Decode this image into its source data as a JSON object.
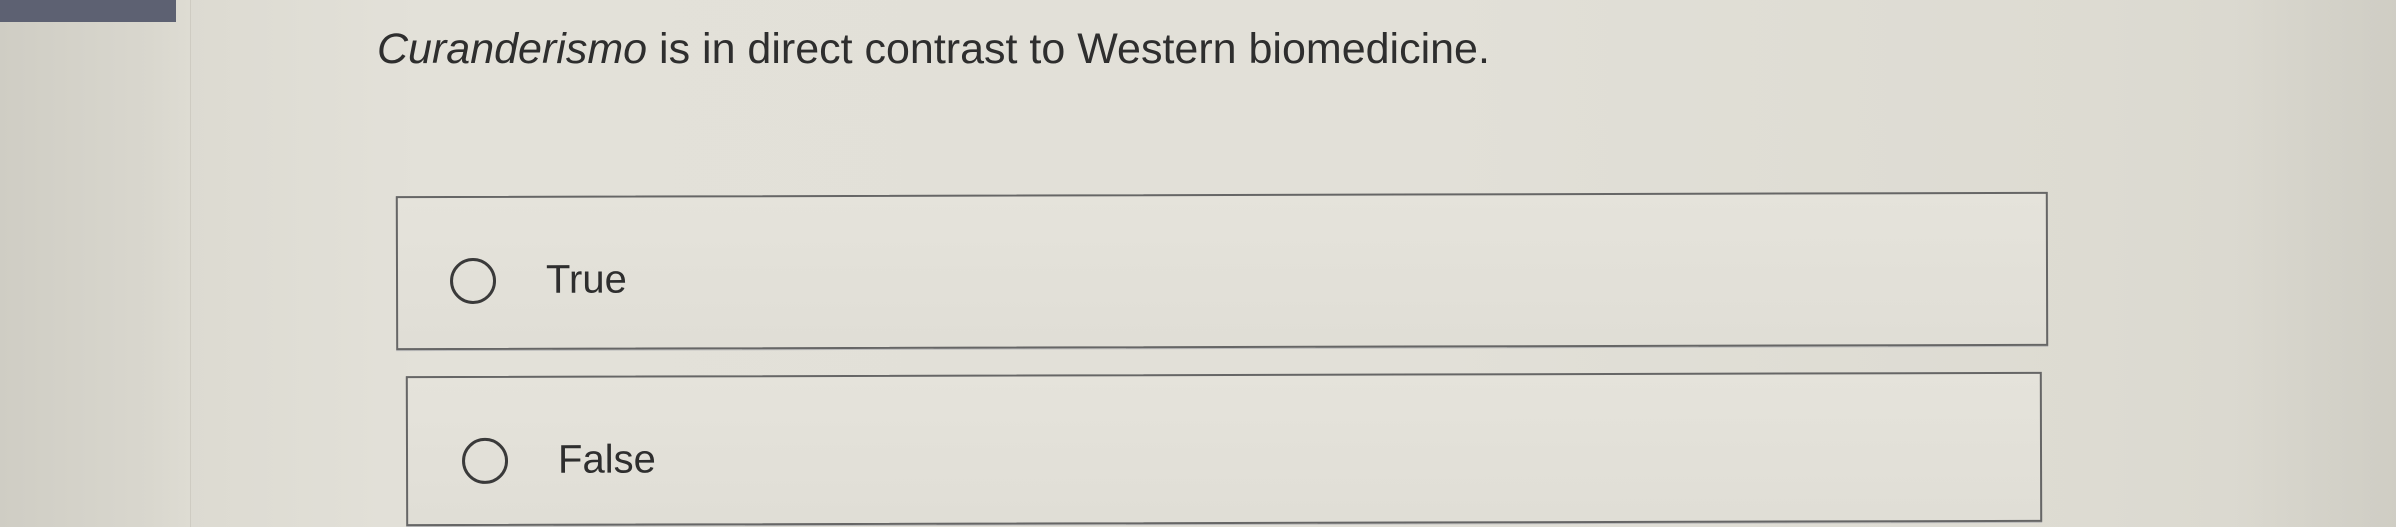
{
  "question": {
    "italic_term": "Curanderismo",
    "text": " is in direct contrast to Western biomedicine."
  },
  "options": [
    {
      "label": "True",
      "selected": false
    },
    {
      "label": "False",
      "selected": false
    }
  ],
  "colors": {
    "top_accent": "#5d6172",
    "border": "#666666",
    "text": "#2e2e2e"
  }
}
